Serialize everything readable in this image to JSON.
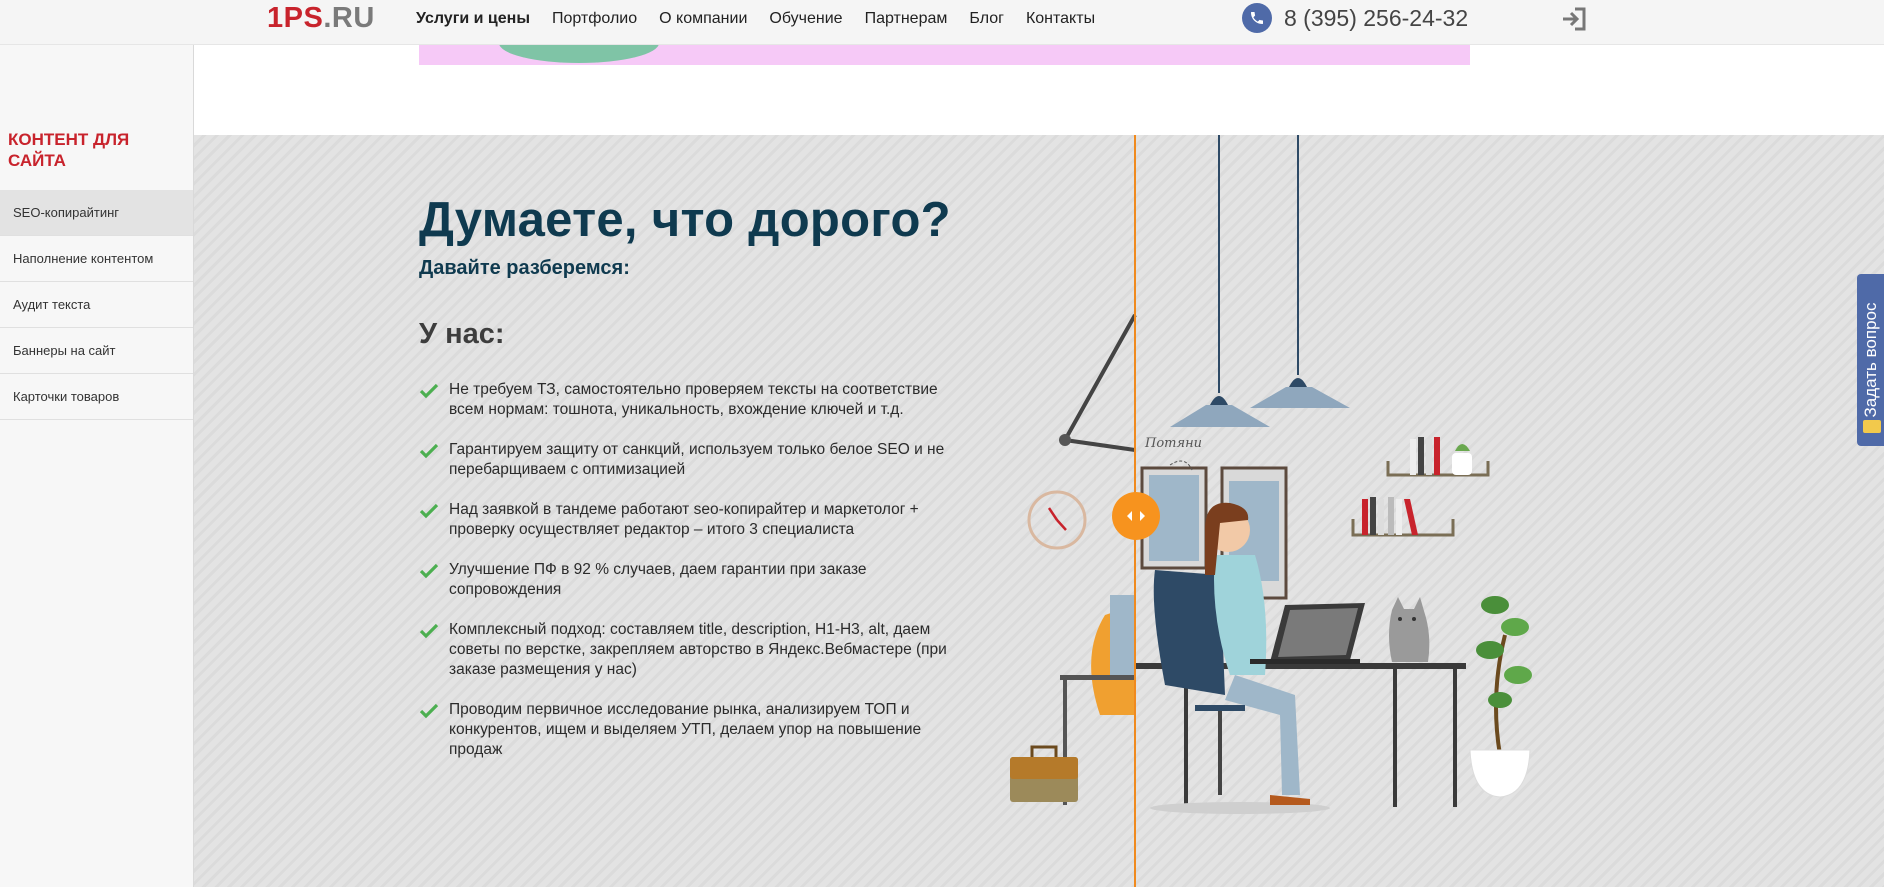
{
  "header": {
    "logo_part1": "1PS",
    "logo_part2": ".RU",
    "nav": [
      "Услуги и цены",
      "Портфолио",
      "О компании",
      "Обучение",
      "Партнерам",
      "Блог",
      "Контакты"
    ],
    "phone": "8 (395) 256-24-32"
  },
  "sidebar": {
    "title": "КОНТЕНТ ДЛЯ САЙТА",
    "items": [
      "SEO-копирайтинг",
      "Наполнение контентом",
      "Аудит текста",
      "Баннеры на сайт",
      "Карточки товаров"
    ]
  },
  "main": {
    "heading": "Думаете, что дорого?",
    "subheading": "Давайте разберемся:",
    "list_title": "У нас:",
    "list": [
      "Не требуем ТЗ, самостоятельно проверяем тексты на соответствие всем нормам: тошнота, уникальность, вхождение ключей и т.д.",
      "Гарантируем защиту от санкций, используем только белое SEO и не перебарщиваем с оптимизацией",
      "Над заявкой в тандеме работают seo-копирайтер и маркетолог + проверку осуществляет редактор – итого 3 специалиста",
      "Улучшение ПФ в 92 % случаев, даем гарантии при заказе сопровождения",
      "Комплексный подход: составляем title, description, H1-H3, alt, даем советы по верстке, закрепляем авторство в Яндекс.Вебмастере (при заказе размещения у нас)",
      "Проводим первичное исследование рынка, анализируем ТОП и конкурентов, ищем и выделяем УТП, делаем упор на повышение продаж"
    ],
    "illustration_note": "Потяни"
  },
  "ask_tab": {
    "label": "Задать вопрос"
  },
  "colors": {
    "brand_red": "#c8232c",
    "navy": "#0f3a4f",
    "accent_orange": "#f7931e",
    "blue_tab": "#4f6aa8",
    "check_green": "#4caf50"
  },
  "icons": [
    "phone-icon",
    "login-icon",
    "check-icon",
    "slider-handle-icon",
    "envelope-icon"
  ]
}
